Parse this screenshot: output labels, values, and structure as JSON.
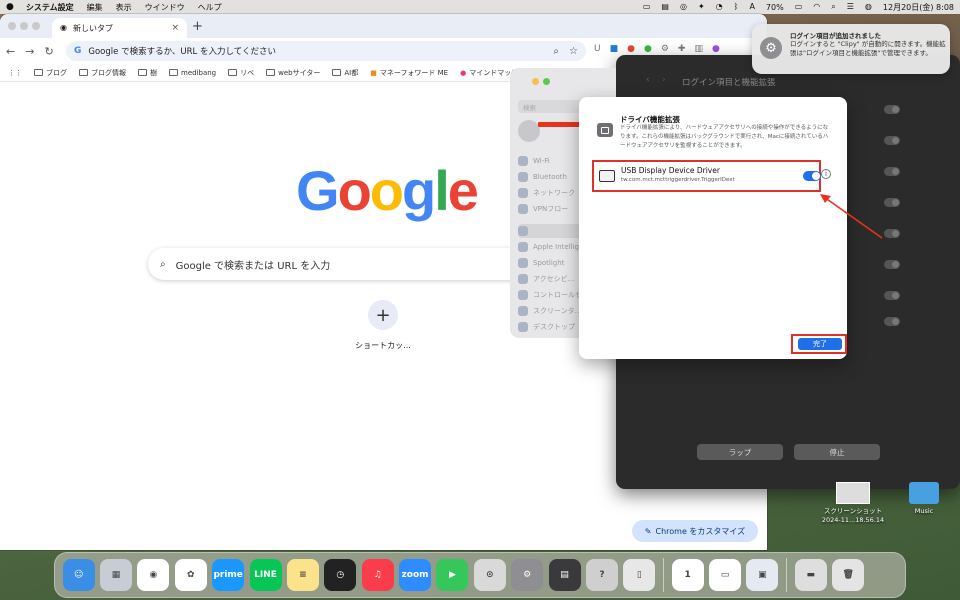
{
  "menubar": {
    "app_name": "システム設定",
    "items": [
      "編集",
      "表示",
      "ウインドウ",
      "ヘルプ"
    ],
    "battery": "70%",
    "datetime": "12月20日(金)  8:08",
    "input_indicator": "A"
  },
  "chrome": {
    "tab_title": "新しいタブ",
    "new_tab": "+",
    "close": "×",
    "omnibox_text": "Google で検索するか、URL を入力してください",
    "bookmarks": [
      "ブログ",
      "ブログ情報",
      "樹",
      "medibang",
      "リベ",
      "webサイター",
      "AI都",
      "マネーフォワード ME",
      "マインドマッピン"
    ],
    "logo": [
      "G",
      "o",
      "o",
      "g",
      "l",
      "e"
    ],
    "logo_colors": [
      "#4285F4",
      "#EA4335",
      "#FBBC05",
      "#4285F4",
      "#34A853",
      "#EA4335"
    ],
    "search_placeholder": "Google で検索または URL を入力",
    "shortcut_label": "ショートカッ...",
    "customize_label": "Chrome をカスタマイズ"
  },
  "settings_window": {
    "title": "ログイン項目と機能拡張",
    "sidebar_search": "検索",
    "sidebar_items": [
      "Wi-Fi",
      "Bluetooth",
      "ネットワーク",
      "VPNフロー",
      "",
      "Apple Intelligence",
      "Spotlight",
      "アクセシビ...",
      "コントロールセ...",
      "スクリーンタ...",
      "デスクトップ"
    ],
    "button_left": "ラップ",
    "button_right": "停止"
  },
  "sheet": {
    "header_title": "ドライバ機能拡張",
    "header_description": "ドライバ機能拡張により、ハードウェアアクセサリへの接続や操作ができるようになります。これらの機能拡張はバックグラウンドで実行され、Macに接続されているハードウェアアクセサリを監視することができます。",
    "driver_name": "USB Display Device Driver",
    "driver_id": "tw.com.mct.mcttriggerdriver.TriggerIDext",
    "driver_enabled": true,
    "info_glyph": "i",
    "done_label": "完了"
  },
  "notification": {
    "title": "ログイン項目が追加されました",
    "body": "ログインすると \"Clipy\" が自動的に開きます。機能拡張は\"ログイン項目と機能拡張\"で管理できます。"
  },
  "desktop": {
    "screenshot_name": "スクリーンショット",
    "screenshot_date": "2024-11...18.56.14",
    "music_label": "Music"
  },
  "dock": {
    "apps": [
      {
        "name": "Finder",
        "color": "#3a8ee6",
        "glyph": "☺"
      },
      {
        "name": "Launchpad",
        "color": "#c8ccd4",
        "glyph": "▦"
      },
      {
        "name": "Chrome",
        "color": "#ffffff",
        "glyph": "◉"
      },
      {
        "name": "Photos",
        "color": "#ffffff",
        "glyph": "✿"
      },
      {
        "name": "Prime Video",
        "color": "#1a98ff",
        "glyph": "prime"
      },
      {
        "name": "LINE",
        "color": "#06c755",
        "glyph": "LINE"
      },
      {
        "name": "Notes",
        "color": "#fbe38b",
        "glyph": "≡"
      },
      {
        "name": "Clock",
        "color": "#222222",
        "glyph": "◷"
      },
      {
        "name": "Music",
        "color": "#fa3c4c",
        "glyph": "♫"
      },
      {
        "name": "Zoom",
        "color": "#2d8cff",
        "glyph": "zoom"
      },
      {
        "name": "FaceTime",
        "color": "#35c759",
        "glyph": "▶"
      },
      {
        "name": "Mouse",
        "color": "#d9d9d9",
        "glyph": "⊙"
      },
      {
        "name": "System Settings",
        "color": "#8e8e93",
        "glyph": "⚙"
      },
      {
        "name": "Calculator",
        "color": "#3a3a3c",
        "glyph": "▤"
      },
      {
        "name": "Help",
        "color": "#cfcfcf",
        "glyph": "?"
      },
      {
        "name": "iPhone Mirroring",
        "color": "#e7e7e7",
        "glyph": "▯"
      },
      {
        "name": "1Password",
        "color": "#ffffff",
        "glyph": "1"
      },
      {
        "name": "Display",
        "color": "#ffffff",
        "glyph": "▭"
      },
      {
        "name": "Preview",
        "color": "#e5eaf2",
        "glyph": "▣"
      },
      {
        "name": "Downloads",
        "color": "#dedede",
        "glyph": "▬"
      },
      {
        "name": "Trash",
        "color": "#e4e4e4",
        "glyph": "🗑"
      }
    ]
  }
}
